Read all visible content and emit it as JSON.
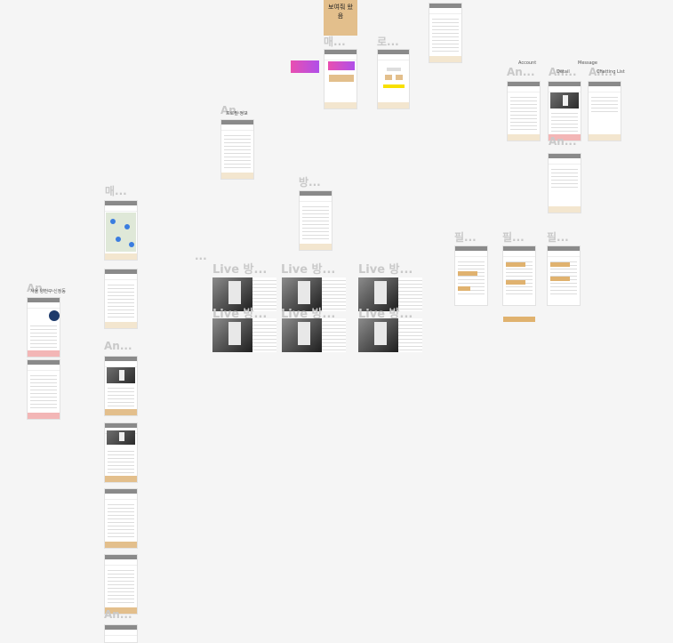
{
  "canvas": {
    "background": "#f5f5f5",
    "label_color": "#c9c9c9",
    "accent": "#e0b26f"
  },
  "labels": {
    "top_tan_text": "보여줘 왔음",
    "mae_top": "매...",
    "ro": "로...",
    "an_main": "An...",
    "an_profile": "An...",
    "an_login": "An...",
    "an_sub": "An...",
    "an_list": "An...",
    "mae_left": "매...",
    "bang": "방...",
    "ellipsis": "...",
    "live1": "Live 방...",
    "live2": "Live 방...",
    "live3": "Live 방...",
    "live4": "Live 방...",
    "live5": "Live 방...",
    "live6": "Live 방...",
    "pil1": "필...",
    "pil2": "필...",
    "pil3": "필...",
    "an_left": "An...",
    "an_left2": "An...",
    "an_bottom": "An...",
    "tiny_account": "Account",
    "tiny_message": "Message",
    "tiny_chat": "Chatting List",
    "tiny_detail": "Detail",
    "tiny_profile": "프로필 정보",
    "tiny_addr": "서울 양천구 신정동"
  }
}
